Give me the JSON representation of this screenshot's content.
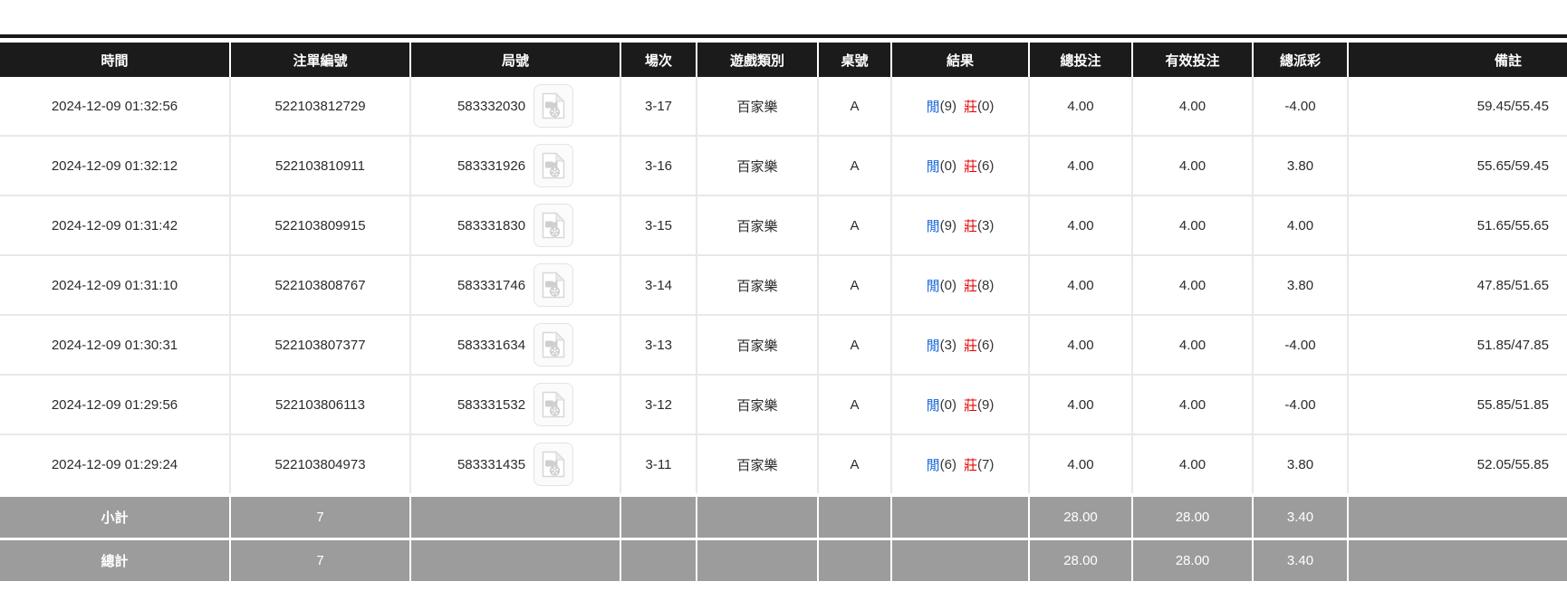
{
  "colors": {
    "header_bg": "#1b1b1b",
    "summary_bg": "#9c9c9c",
    "player_blue": "#1766dc",
    "banker_red": "#e60000",
    "total_bet_blue": "#1766dc",
    "negative_payout_red": "#e60000",
    "row_border": "#e8e8e8"
  },
  "icons": {
    "video_replay": "video-file-icon"
  },
  "table": {
    "columns": [
      {
        "key": "time",
        "label": "時間"
      },
      {
        "key": "bet_id",
        "label": "注單編號"
      },
      {
        "key": "round",
        "label": "局號"
      },
      {
        "key": "session",
        "label": "場次"
      },
      {
        "key": "game_type",
        "label": "遊戲類別"
      },
      {
        "key": "table_no",
        "label": "桌號"
      },
      {
        "key": "result",
        "label": "結果"
      },
      {
        "key": "total_bet",
        "label": "總投注"
      },
      {
        "key": "valid_bet",
        "label": "有效投注"
      },
      {
        "key": "total_payout",
        "label": "總派彩"
      },
      {
        "key": "remark",
        "label": "備註"
      }
    ],
    "rows": [
      {
        "time": "2024-12-09 01:32:56",
        "bet_id": "522103812729",
        "round": "583332030",
        "session": "3-17",
        "game_type": "百家樂",
        "table_no": "A",
        "result": {
          "player_label": "閒",
          "player_value": "(9)",
          "banker_label": "莊",
          "banker_value": "(0)"
        },
        "total_bet": "4.00",
        "valid_bet": "4.00",
        "total_payout": "-4.00",
        "remark": "59.45/55.45"
      },
      {
        "time": "2024-12-09 01:32:12",
        "bet_id": "522103810911",
        "round": "583331926",
        "session": "3-16",
        "game_type": "百家樂",
        "table_no": "A",
        "result": {
          "player_label": "閒",
          "player_value": "(0)",
          "banker_label": "莊",
          "banker_value": "(6)"
        },
        "total_bet": "4.00",
        "valid_bet": "4.00",
        "total_payout": "3.80",
        "remark": "55.65/59.45"
      },
      {
        "time": "2024-12-09 01:31:42",
        "bet_id": "522103809915",
        "round": "583331830",
        "session": "3-15",
        "game_type": "百家樂",
        "table_no": "A",
        "result": {
          "player_label": "閒",
          "player_value": "(9)",
          "banker_label": "莊",
          "banker_value": "(3)"
        },
        "total_bet": "4.00",
        "valid_bet": "4.00",
        "total_payout": "4.00",
        "remark": "51.65/55.65"
      },
      {
        "time": "2024-12-09 01:31:10",
        "bet_id": "522103808767",
        "round": "583331746",
        "session": "3-14",
        "game_type": "百家樂",
        "table_no": "A",
        "result": {
          "player_label": "閒",
          "player_value": "(0)",
          "banker_label": "莊",
          "banker_value": "(8)"
        },
        "total_bet": "4.00",
        "valid_bet": "4.00",
        "total_payout": "3.80",
        "remark": "47.85/51.65"
      },
      {
        "time": "2024-12-09 01:30:31",
        "bet_id": "522103807377",
        "round": "583331634",
        "session": "3-13",
        "game_type": "百家樂",
        "table_no": "A",
        "result": {
          "player_label": "閒",
          "player_value": "(3)",
          "banker_label": "莊",
          "banker_value": "(6)"
        },
        "total_bet": "4.00",
        "valid_bet": "4.00",
        "total_payout": "-4.00",
        "remark": "51.85/47.85"
      },
      {
        "time": "2024-12-09 01:29:56",
        "bet_id": "522103806113",
        "round": "583331532",
        "session": "3-12",
        "game_type": "百家樂",
        "table_no": "A",
        "result": {
          "player_label": "閒",
          "player_value": "(0)",
          "banker_label": "莊",
          "banker_value": "(9)"
        },
        "total_bet": "4.00",
        "valid_bet": "4.00",
        "total_payout": "-4.00",
        "remark": "55.85/51.85"
      },
      {
        "time": "2024-12-09 01:29:24",
        "bet_id": "522103804973",
        "round": "583331435",
        "session": "3-11",
        "game_type": "百家樂",
        "table_no": "A",
        "result": {
          "player_label": "閒",
          "player_value": "(6)",
          "banker_label": "莊",
          "banker_value": "(7)"
        },
        "total_bet": "4.00",
        "valid_bet": "4.00",
        "total_payout": "3.80",
        "remark": "52.05/55.85"
      }
    ],
    "subtotal": {
      "label": "小計",
      "bet_count": "7",
      "total_bet": "28.00",
      "valid_bet": "28.00",
      "total_payout": "3.40"
    },
    "total": {
      "label": "總計",
      "bet_count": "7",
      "total_bet": "28.00",
      "valid_bet": "28.00",
      "total_payout": "3.40"
    }
  }
}
